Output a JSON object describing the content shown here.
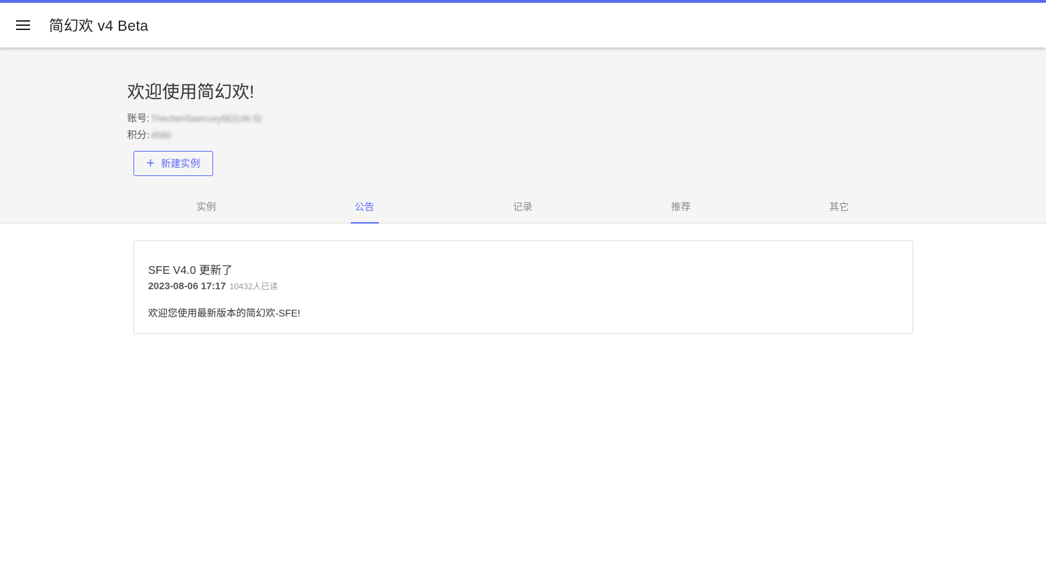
{
  "app": {
    "title": "简幻欢 v4 Beta",
    "accent_color": "#5b6cf2",
    "menu_icon": "menu-icon"
  },
  "header": {
    "welcome": "欢迎使用简幻欢!",
    "account_label": "账号:",
    "account_value": "Thechen5aercury6E(U4t-S)",
    "points_label": "积分:",
    "points_value": "4590",
    "new_instance_label": "新建实例",
    "new_instance_icon": "plus-icon"
  },
  "tabs": [
    {
      "label": "实例",
      "active": false
    },
    {
      "label": "公告",
      "active": true
    },
    {
      "label": "记录",
      "active": false
    },
    {
      "label": "推荐",
      "active": false
    },
    {
      "label": "其它",
      "active": false
    }
  ],
  "announcement": {
    "title": "SFE V4.0 更新了",
    "date": "2023-08-06 17:17",
    "reads": "10432人已读",
    "body": "欢迎您使用最新版本的简幻欢-SFE!"
  }
}
